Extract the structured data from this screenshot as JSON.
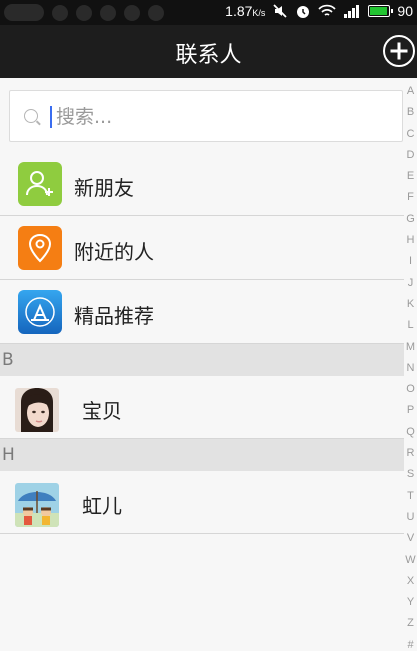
{
  "status_bar": {
    "network_speed": "1.87",
    "network_unit": "K/s",
    "battery_level": "90",
    "battery_fraction": 0.9,
    "colors": {
      "background": "#111111",
      "battery_fill": "#22c431"
    },
    "icons": [
      "mute-icon",
      "alarm-icon",
      "wifi-icon",
      "signal-icon",
      "battery-icon"
    ]
  },
  "header": {
    "title": "联系人",
    "add_button_icon": "plus-circle-icon"
  },
  "search": {
    "placeholder": "搜索...",
    "value": "",
    "icon": "search-icon"
  },
  "functions": [
    {
      "label": "新朋友",
      "icon": "add-friend-icon",
      "color": "#8fcc3f"
    },
    {
      "label": "附近的人",
      "icon": "location-pin-icon",
      "color": "#f57e13"
    },
    {
      "label": "精品推荐",
      "icon": "app-store-icon",
      "color": "#1b7fd0"
    }
  ],
  "sections": [
    {
      "letter": "B",
      "contacts": [
        {
          "name": "宝贝",
          "avatar": "girl-portrait-avatar"
        }
      ]
    },
    {
      "letter": "H",
      "contacts": [
        {
          "name": "虹儿",
          "avatar": "cartoon-umbrella-avatar"
        }
      ]
    }
  ],
  "index_letters": [
    "A",
    "B",
    "C",
    "D",
    "E",
    "F",
    "G",
    "H",
    "I",
    "J",
    "K",
    "L",
    "M",
    "N",
    "O",
    "P",
    "Q",
    "R",
    "S",
    "T",
    "U",
    "V",
    "W",
    "X",
    "Y",
    "Z",
    "#"
  ]
}
